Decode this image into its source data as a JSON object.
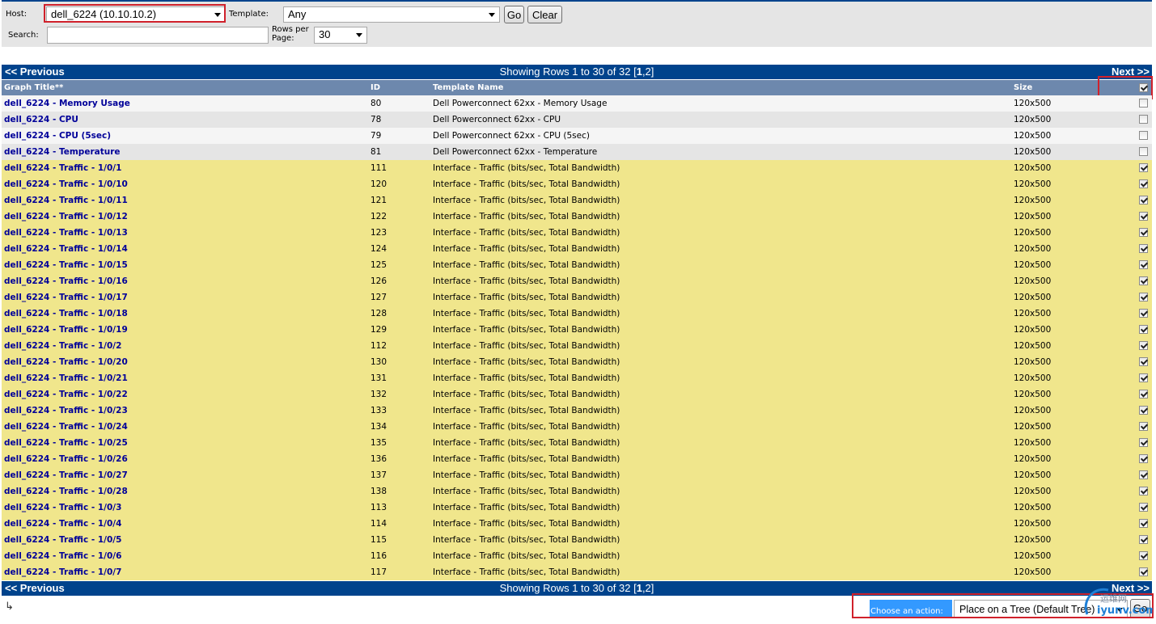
{
  "filter": {
    "host_label": "Host:",
    "host_value": "dell_6224 (10.10.10.2)",
    "template_label": "Template:",
    "template_value": "Any",
    "go_label": "Go",
    "clear_label": "Clear",
    "search_label": "Search:",
    "search_value": "",
    "rows_per_page_label_1": "Rows per",
    "rows_per_page_label_2": "Page:",
    "rows_per_page_value": "30"
  },
  "nav": {
    "previous": "<< Previous",
    "next": "Next >>",
    "showing_prefix": "Showing Rows 1 to 30 of 32 [",
    "current_page": "1",
    "other_pages": ",2]"
  },
  "table": {
    "headers": {
      "title": "Graph Title**",
      "id": "ID",
      "template": "Template Name",
      "size": "Size"
    },
    "select_all_checked": true,
    "rows": [
      {
        "title": "dell_6224 - Memory Usage",
        "id": "80",
        "template": "Dell Powerconnect 62xx - Memory Usage",
        "size": "120x500",
        "checked": false
      },
      {
        "title": "dell_6224 - CPU",
        "id": "78",
        "template": "Dell Powerconnect 62xx - CPU",
        "size": "120x500",
        "checked": false
      },
      {
        "title": "dell_6224 - CPU (5sec)",
        "id": "79",
        "template": "Dell Powerconnect 62xx - CPU (5sec)",
        "size": "120x500",
        "checked": false
      },
      {
        "title": "dell_6224 - Temperature",
        "id": "81",
        "template": "Dell Powerconnect 62xx - Temperature",
        "size": "120x500",
        "checked": false
      },
      {
        "title": "dell_6224 - Traffic - 1/0/1",
        "id": "111",
        "template": "Interface - Traffic (bits/sec, Total Bandwidth)",
        "size": "120x500",
        "checked": true
      },
      {
        "title": "dell_6224 - Traffic - 1/0/10",
        "id": "120",
        "template": "Interface - Traffic (bits/sec, Total Bandwidth)",
        "size": "120x500",
        "checked": true
      },
      {
        "title": "dell_6224 - Traffic - 1/0/11",
        "id": "121",
        "template": "Interface - Traffic (bits/sec, Total Bandwidth)",
        "size": "120x500",
        "checked": true
      },
      {
        "title": "dell_6224 - Traffic - 1/0/12",
        "id": "122",
        "template": "Interface - Traffic (bits/sec, Total Bandwidth)",
        "size": "120x500",
        "checked": true
      },
      {
        "title": "dell_6224 - Traffic - 1/0/13",
        "id": "123",
        "template": "Interface - Traffic (bits/sec, Total Bandwidth)",
        "size": "120x500",
        "checked": true
      },
      {
        "title": "dell_6224 - Traffic - 1/0/14",
        "id": "124",
        "template": "Interface - Traffic (bits/sec, Total Bandwidth)",
        "size": "120x500",
        "checked": true
      },
      {
        "title": "dell_6224 - Traffic - 1/0/15",
        "id": "125",
        "template": "Interface - Traffic (bits/sec, Total Bandwidth)",
        "size": "120x500",
        "checked": true
      },
      {
        "title": "dell_6224 - Traffic - 1/0/16",
        "id": "126",
        "template": "Interface - Traffic (bits/sec, Total Bandwidth)",
        "size": "120x500",
        "checked": true
      },
      {
        "title": "dell_6224 - Traffic - 1/0/17",
        "id": "127",
        "template": "Interface - Traffic (bits/sec, Total Bandwidth)",
        "size": "120x500",
        "checked": true
      },
      {
        "title": "dell_6224 - Traffic - 1/0/18",
        "id": "128",
        "template": "Interface - Traffic (bits/sec, Total Bandwidth)",
        "size": "120x500",
        "checked": true
      },
      {
        "title": "dell_6224 - Traffic - 1/0/19",
        "id": "129",
        "template": "Interface - Traffic (bits/sec, Total Bandwidth)",
        "size": "120x500",
        "checked": true
      },
      {
        "title": "dell_6224 - Traffic - 1/0/2",
        "id": "112",
        "template": "Interface - Traffic (bits/sec, Total Bandwidth)",
        "size": "120x500",
        "checked": true
      },
      {
        "title": "dell_6224 - Traffic - 1/0/20",
        "id": "130",
        "template": "Interface - Traffic (bits/sec, Total Bandwidth)",
        "size": "120x500",
        "checked": true
      },
      {
        "title": "dell_6224 - Traffic - 1/0/21",
        "id": "131",
        "template": "Interface - Traffic (bits/sec, Total Bandwidth)",
        "size": "120x500",
        "checked": true
      },
      {
        "title": "dell_6224 - Traffic - 1/0/22",
        "id": "132",
        "template": "Interface - Traffic (bits/sec, Total Bandwidth)",
        "size": "120x500",
        "checked": true
      },
      {
        "title": "dell_6224 - Traffic - 1/0/23",
        "id": "133",
        "template": "Interface - Traffic (bits/sec, Total Bandwidth)",
        "size": "120x500",
        "checked": true
      },
      {
        "title": "dell_6224 - Traffic - 1/0/24",
        "id": "134",
        "template": "Interface - Traffic (bits/sec, Total Bandwidth)",
        "size": "120x500",
        "checked": true
      },
      {
        "title": "dell_6224 - Traffic - 1/0/25",
        "id": "135",
        "template": "Interface - Traffic (bits/sec, Total Bandwidth)",
        "size": "120x500",
        "checked": true
      },
      {
        "title": "dell_6224 - Traffic - 1/0/26",
        "id": "136",
        "template": "Interface - Traffic (bits/sec, Total Bandwidth)",
        "size": "120x500",
        "checked": true
      },
      {
        "title": "dell_6224 - Traffic - 1/0/27",
        "id": "137",
        "template": "Interface - Traffic (bits/sec, Total Bandwidth)",
        "size": "120x500",
        "checked": true
      },
      {
        "title": "dell_6224 - Traffic - 1/0/28",
        "id": "138",
        "template": "Interface - Traffic (bits/sec, Total Bandwidth)",
        "size": "120x500",
        "checked": true
      },
      {
        "title": "dell_6224 - Traffic - 1/0/3",
        "id": "113",
        "template": "Interface - Traffic (bits/sec, Total Bandwidth)",
        "size": "120x500",
        "checked": true
      },
      {
        "title": "dell_6224 - Traffic - 1/0/4",
        "id": "114",
        "template": "Interface - Traffic (bits/sec, Total Bandwidth)",
        "size": "120x500",
        "checked": true
      },
      {
        "title": "dell_6224 - Traffic - 1/0/5",
        "id": "115",
        "template": "Interface - Traffic (bits/sec, Total Bandwidth)",
        "size": "120x500",
        "checked": true
      },
      {
        "title": "dell_6224 - Traffic - 1/0/6",
        "id": "116",
        "template": "Interface - Traffic (bits/sec, Total Bandwidth)",
        "size": "120x500",
        "checked": true
      },
      {
        "title": "dell_6224 - Traffic - 1/0/7",
        "id": "117",
        "template": "Interface - Traffic (bits/sec, Total Bandwidth)",
        "size": "120x500",
        "checked": true
      }
    ]
  },
  "actions": {
    "enter_icon": "↳",
    "choose_label": "Choose an action:",
    "action_value": "Place on a Tree (Default Tree)",
    "go_label": "Go"
  },
  "watermark": {
    "top": "运维网",
    "bottom": "iyunv.com"
  },
  "colors": {
    "nav_blue": "#00438c",
    "header_blue": "#6d88ad",
    "selected_row": "#f0e68c",
    "link_blue": "#000099",
    "highlight_red": "#d0212b"
  }
}
